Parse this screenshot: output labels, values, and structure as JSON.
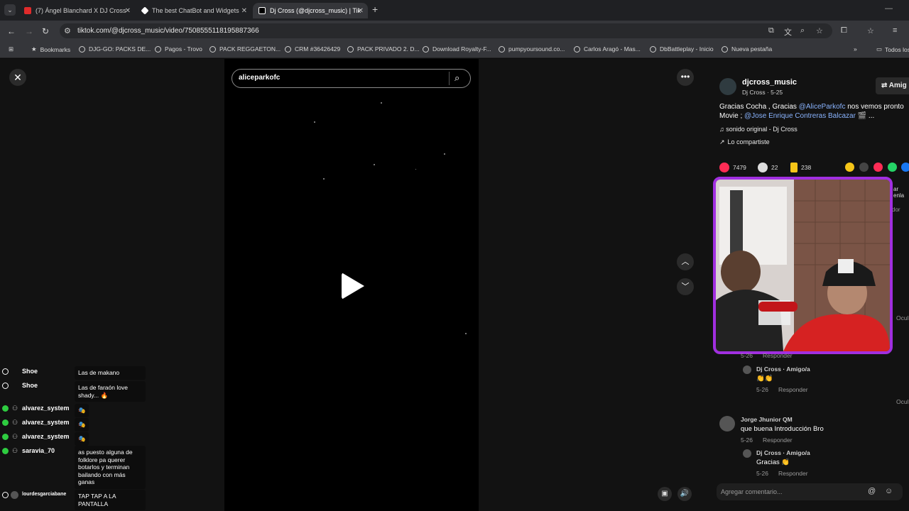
{
  "browser": {
    "tabs": [
      {
        "title": "(7) Ángel Blanchard X DJ Cross",
        "close": "✕"
      },
      {
        "title": "The best ChatBot and Widgets",
        "close": "✕"
      },
      {
        "title": "Dj Cross (@djcross_music) | Tik",
        "close": "✕"
      }
    ],
    "new_tab": "+",
    "url": "tiktok.com/@djcross_music/video/7508555118195887366",
    "bookmarks": [
      "Bookmarks",
      "DJG-GO: PACKS DE...",
      "Pagos - Trovo",
      "PACK REGGAETON...",
      "CRM #36426429",
      "PACK PRIVADO 2. D...",
      "Download Royalty-F...",
      "pumpyoursound.co...",
      "Carlos Aragó - Mas...",
      "DbBattleplay - Inicio",
      "Nueva pestaña"
    ],
    "all_bookmarks": "Todos los"
  },
  "search": {
    "value": "aliceparkofc"
  },
  "post": {
    "username": "djcross_music",
    "subline": "Dj Cross · 5-25",
    "friend_button": "⇄ Amig",
    "desc_start": "Gracias Cocha , Gracias ",
    "mention1": "@AliceParkofc",
    "desc_mid": " nos vemos pronto Movie ; ",
    "mention2": "@Jose Enrique Contreras Balcazar",
    "desc_end": " 🎬 ...",
    "music": "♫  sonido original - Dj Cross",
    "shared": "Lo compartiste",
    "likes": "7479",
    "comments": "22",
    "saves": "238",
    "side_clip_1": "ar enla",
    "side_clip_2": "dor"
  },
  "comments": [
    {
      "reply_meta": "5-26",
      "reply_label": "Responder"
    },
    {
      "name": "Dj Cross · Amigo/a",
      "text": "👏👏",
      "date": "5-26",
      "reply": "Responder"
    },
    {
      "name": "Jorge Jhunior QM",
      "text": "que buena Introducción Bro",
      "date": "5-26",
      "reply": "Responder"
    },
    {
      "name": "Dj Cross · Amigo/a",
      "text": "Gracias 👏",
      "date": "5-26",
      "reply": "Responder"
    }
  ],
  "ocultar": "Ocul",
  "comment_input": {
    "placeholder": "Agregar comentario..."
  },
  "chat": [
    {
      "user": "Shoe",
      "msg": "Las de makano"
    },
    {
      "user": "Shoe",
      "msg": "Las de faraón love shady... 🔥"
    },
    {
      "user": "alvarez_system",
      "msg": "🎭"
    },
    {
      "user": "alvarez_system",
      "msg": "🎭"
    },
    {
      "user": "alvarez_system",
      "msg": "🎭"
    },
    {
      "user": "saravia_70",
      "msg": "as puesto alguna de folklore pa querer botarlos y terminan bailando con más ganas"
    },
    {
      "user": "lourdesgarciabane",
      "msg": "TAP TAP A LA PANTALLA"
    }
  ],
  "colors": {
    "accent_like": "#fe2c55",
    "mention": "#8ab4ff",
    "webcam_border": "#a12fe0"
  },
  "icons": {
    "close": "✕",
    "more": "•••",
    "up": "︿",
    "down": "﹀",
    "search": "⌕"
  }
}
